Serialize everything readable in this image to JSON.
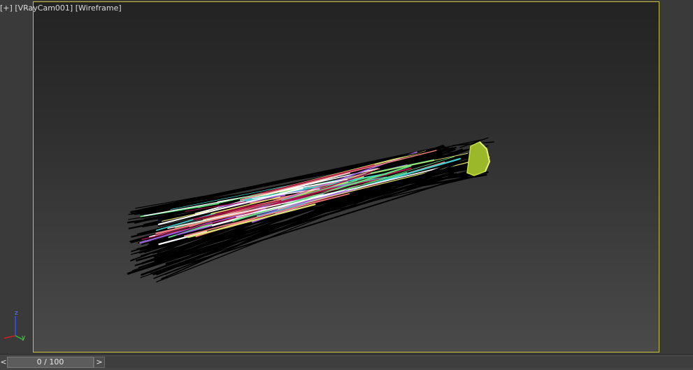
{
  "viewport": {
    "label_parts": [
      "[+]",
      "[VRayCam001]",
      "[Wireframe]"
    ],
    "colors": {
      "safe_frame_border": "#c8c23a",
      "background_top": "#232323",
      "background_bottom": "#4a4a4a"
    },
    "scene_object": {
      "description_icon": "hair-strands-wireframe",
      "strand_colors": [
        "#000000",
        "#b0144a",
        "#e0e070",
        "#40d0d0",
        "#a060e0",
        "#f08080",
        "#60e080",
        "#ffffff",
        "#9ab82a"
      ]
    }
  },
  "axis_gizmo": {
    "z_label": "z",
    "y_label": "y",
    "colors": {
      "x": "#d02020",
      "y": "#30c030",
      "z": "#3050ff"
    }
  },
  "timeline": {
    "prev_label": "<",
    "slider_text": "0 / 100",
    "next_label": ">",
    "current_frame": 0,
    "total_frames": 100
  }
}
